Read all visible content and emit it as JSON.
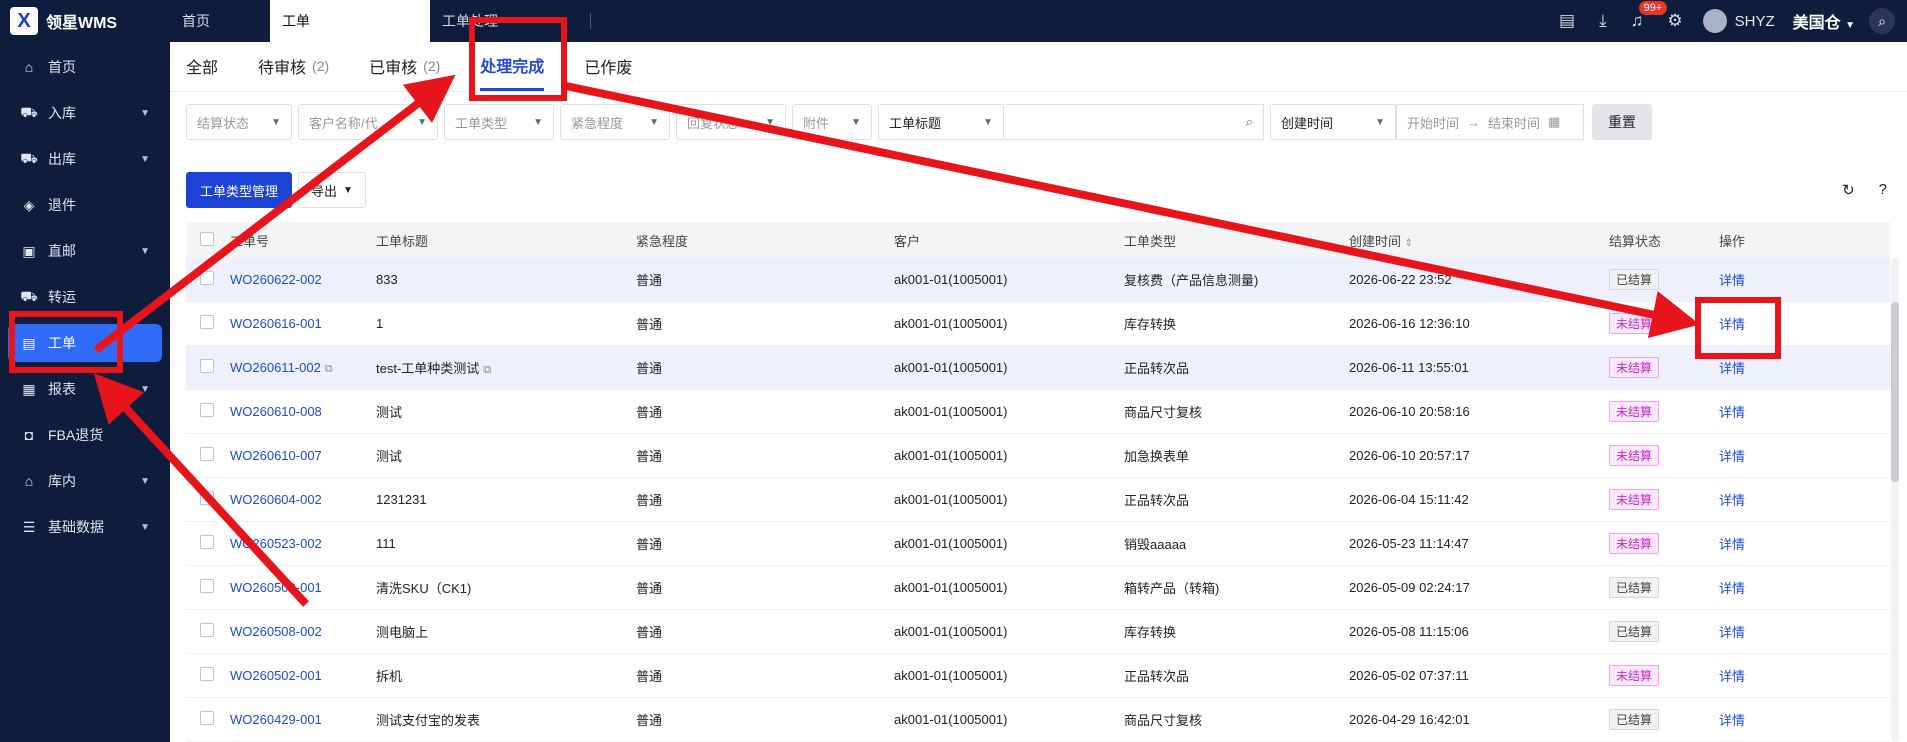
{
  "app": {
    "logo_glyph": "X",
    "name": "领星WMS"
  },
  "top_tabs": [
    {
      "label": "首页"
    },
    {
      "label": "工单"
    },
    {
      "label": "工单处理"
    }
  ],
  "top_right": {
    "badge": "99+",
    "username": "SHYZ",
    "warehouse": "美国仓"
  },
  "sidebar": [
    {
      "label": "首页",
      "icon": "home-icon",
      "glyph": "⌂",
      "chevron": false
    },
    {
      "label": "入库",
      "icon": "inbound-icon",
      "glyph": "⛟",
      "chevron": true
    },
    {
      "label": "出库",
      "icon": "outbound-icon",
      "glyph": "⛟",
      "chevron": true
    },
    {
      "label": "退件",
      "icon": "return-icon",
      "glyph": "◈",
      "chevron": false
    },
    {
      "label": "直邮",
      "icon": "mail-icon",
      "glyph": "▣",
      "chevron": true
    },
    {
      "label": "转运",
      "icon": "transfer-icon",
      "glyph": "⛟",
      "chevron": false
    },
    {
      "label": "工单",
      "icon": "workorder-icon",
      "glyph": "▤",
      "chevron": false,
      "active": true
    },
    {
      "label": "报表",
      "icon": "report-icon",
      "glyph": "▦",
      "chevron": true
    },
    {
      "label": "FBA退货",
      "icon": "fba-icon",
      "glyph": "◘",
      "chevron": false
    },
    {
      "label": "库内",
      "icon": "warehouse-icon",
      "glyph": "⌂",
      "chevron": true
    },
    {
      "label": "基础数据",
      "icon": "data-icon",
      "glyph": "☰",
      "chevron": true
    }
  ],
  "subtabs": [
    {
      "label": "全部",
      "count": ""
    },
    {
      "label": "待审核",
      "count": "(2)"
    },
    {
      "label": "已审核",
      "count": "(2)"
    },
    {
      "label": "处理完成",
      "count": "",
      "active": true
    },
    {
      "label": "已作废",
      "count": ""
    }
  ],
  "filters": {
    "settle_status": "结算状态",
    "customer": "客户名称/代",
    "order_type": "工单类型",
    "urgency": "紧急程度",
    "reply_status": "回复状态",
    "attachment": "附件",
    "search_field": "工单标题",
    "time_field": "创建时间",
    "start_time": "开始时间",
    "end_time": "结束时间",
    "reset": "重置"
  },
  "toolbar": {
    "manage_types": "工单类型管理",
    "export": "导出"
  },
  "columns": [
    "工单号",
    "工单标题",
    "紧急程度",
    "客户",
    "工单类型",
    "创建时间",
    "结算状态",
    "操作"
  ],
  "rows": [
    {
      "no": "WO260622-002",
      "title": "833",
      "urgency": "普通",
      "customer": "ak001-01(1005001)",
      "type": "复核费（产品信息测量)",
      "time": "2026-06-22 23:52",
      "status": "已结算",
      "op": "详情",
      "hl": true
    },
    {
      "no": "WO260616-001",
      "title": "1",
      "urgency": "普通",
      "customer": "ak001-01(1005001)",
      "type": "库存转换",
      "time": "2026-06-16 12:36:10",
      "status": "未结算",
      "op": "详情"
    },
    {
      "no": "WO260611-002",
      "title": "test-工单种类测试",
      "urgency": "普通",
      "customer": "ak001-01(1005001)",
      "type": "正品转次品",
      "time": "2026-06-11 13:55:01",
      "status": "未结算",
      "op": "详情",
      "hl": true,
      "copy": true
    },
    {
      "no": "WO260610-008",
      "title": "测试",
      "urgency": "普通",
      "customer": "ak001-01(1005001)",
      "type": "商品尺寸复核",
      "time": "2026-06-10 20:58:16",
      "status": "未结算",
      "op": "详情"
    },
    {
      "no": "WO260610-007",
      "title": "测试",
      "urgency": "普通",
      "customer": "ak001-01(1005001)",
      "type": "加急换表单",
      "time": "2026-06-10 20:57:17",
      "status": "未结算",
      "op": "详情"
    },
    {
      "no": "WO260604-002",
      "title": "1231231",
      "urgency": "普通",
      "customer": "ak001-01(1005001)",
      "type": "正品转次品",
      "time": "2026-06-04 15:11:42",
      "status": "未结算",
      "op": "详情"
    },
    {
      "no": "WO260523-002",
      "title": "111",
      "urgency": "普通",
      "customer": "ak001-01(1005001)",
      "type": "销毁aaaaa",
      "time": "2026-05-23 11:14:47",
      "status": "未结算",
      "op": "详情"
    },
    {
      "no": "WO260509-001",
      "title": "清洗SKU（CK1)",
      "urgency": "普通",
      "customer": "ak001-01(1005001)",
      "type": "箱转产品（转箱)",
      "time": "2026-05-09 02:24:17",
      "status": "已结算",
      "op": "详情"
    },
    {
      "no": "WO260508-002",
      "title": "测电脑上",
      "urgency": "普通",
      "customer": "ak001-01(1005001)",
      "type": "库存转换",
      "time": "2026-05-08 11:15:06",
      "status": "已结算",
      "op": "详情"
    },
    {
      "no": "WO260502-001",
      "title": "拆机",
      "urgency": "普通",
      "customer": "ak001-01(1005001)",
      "type": "正品转次品",
      "time": "2026-05-02 07:37:11",
      "status": "未结算",
      "op": "详情"
    },
    {
      "no": "WO260429-001",
      "title": "测试支付宝的发表",
      "urgency": "普通",
      "customer": "ak001-01(1005001)",
      "type": "商品尺寸复核",
      "time": "2026-04-29 16:42:01",
      "status": "已结算",
      "op": "详情"
    }
  ],
  "colors": {
    "accent": "#2248d8",
    "sidebar_bg": "#0f1d3d",
    "annotation": "#e8141c",
    "unsettled": "#c22ac9"
  }
}
